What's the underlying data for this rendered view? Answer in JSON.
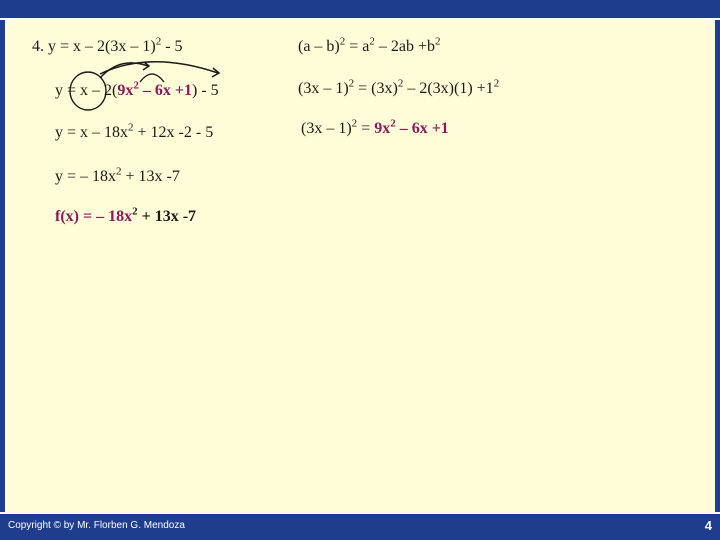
{
  "problem": {
    "l1": {
      "a": "4. y = x – 2(3x – 1)",
      "exp": "2",
      "b": " - 5"
    },
    "l2": {
      "a": "y = x – 2(",
      "h1": "9x",
      "h1exp": "2",
      "h2": " – 6x +1",
      "b": ") - 5"
    },
    "l3": {
      "a": "y = x – 18x",
      "exp": "2",
      "b": " + 12x -2 - 5"
    },
    "l4": {
      "a": "y = – 18x",
      "exp": "2",
      "b": " + 13x -7"
    },
    "l5": {
      "a": "f(x) = – 18x",
      "exp": "2",
      "b": " + 13x -7"
    }
  },
  "formula": {
    "f1": {
      "a": "(a – b)",
      "e1": "2",
      "b": " = a",
      "e2": "2",
      "c": " – 2ab +b",
      "e3": "2"
    },
    "f2": {
      "a": "(3x – 1)",
      "e1": "2",
      "b": " = (3x)",
      "e2": "2",
      "c": " – 2(3x)(1) +1",
      "e3": "2"
    },
    "f3": {
      "a": "(3x – 1)",
      "e1": "2",
      "b": " = ",
      "c": "9x",
      "e2": "2",
      "d": " – 6x +1"
    }
  },
  "footer": {
    "copyright": "Copyright © by Mr. Florben G. Mendoza",
    "page": "4"
  },
  "colors": {
    "frame": "#1f3d8f",
    "background": "#fefdd8",
    "highlight": "#8b1a5c"
  }
}
